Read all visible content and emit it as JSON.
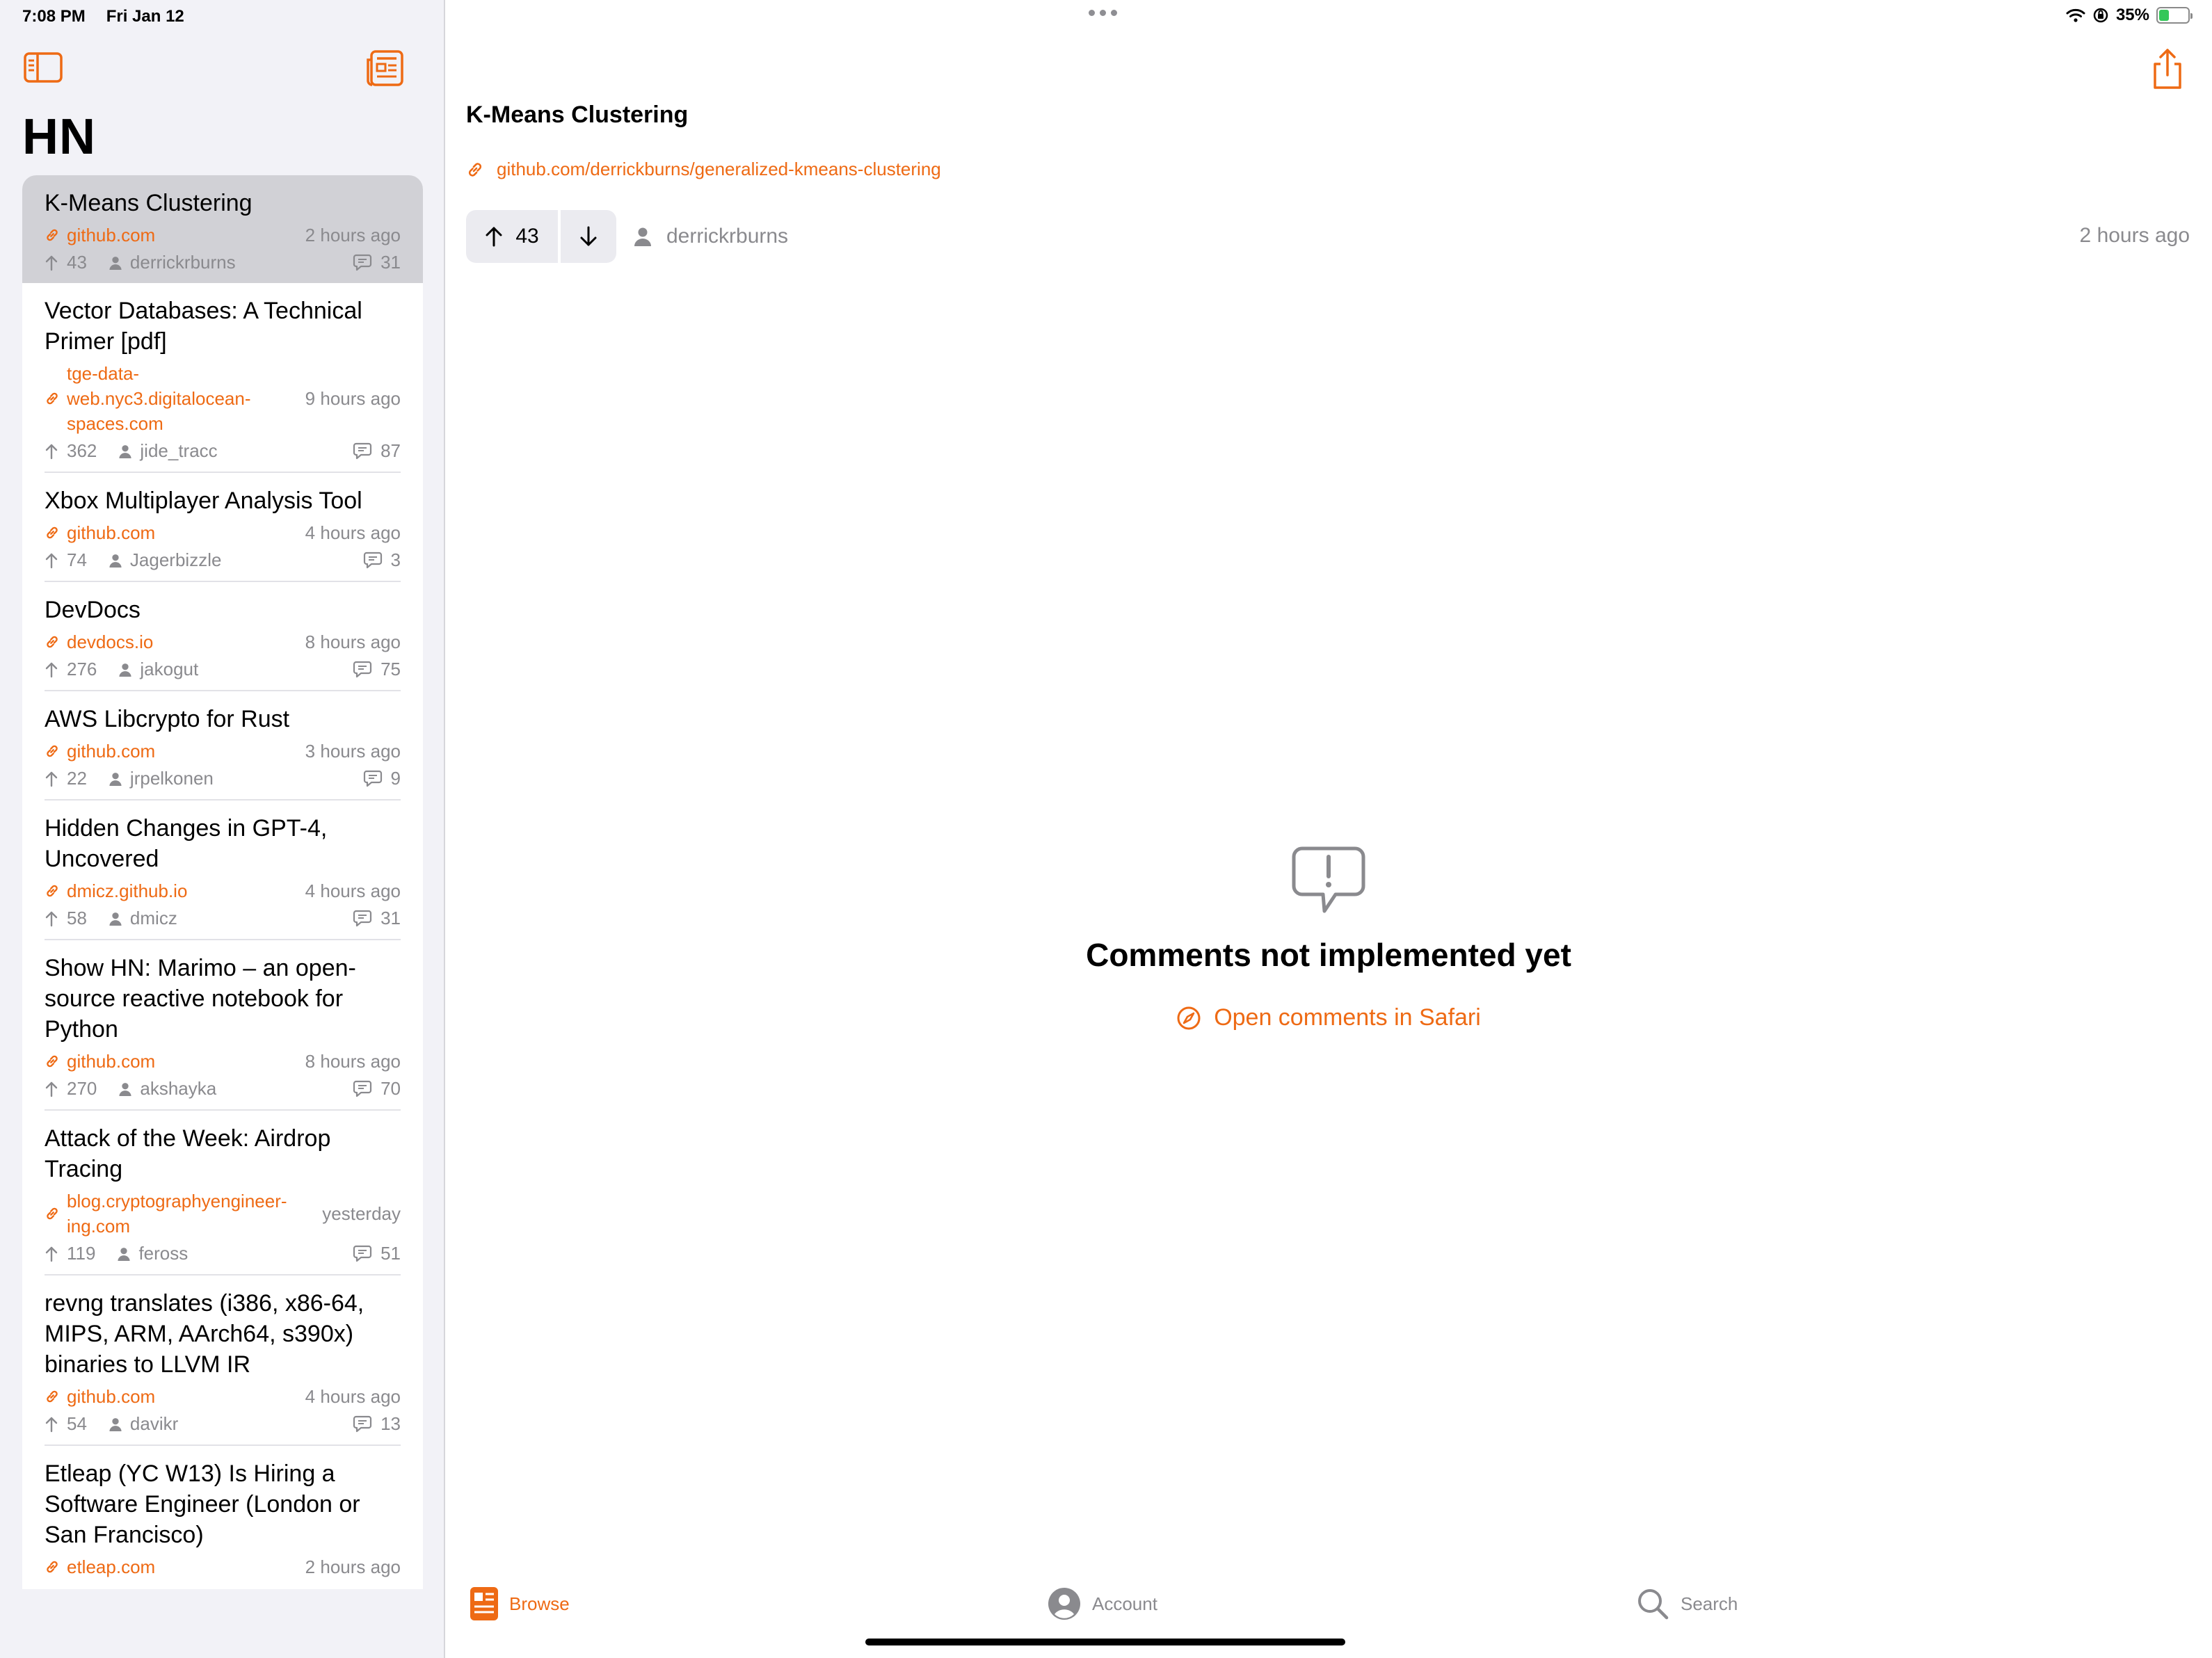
{
  "status_bar": {
    "time": "7:08 PM",
    "date": "Fri Jan 12",
    "battery": "35%",
    "battery_level": 0.35
  },
  "sidebar": {
    "title": "HN",
    "stories": [
      {
        "title": "K-Means Clustering",
        "site": "github.com",
        "age": "2 hours ago",
        "points": "43",
        "user": "derrickrburns",
        "comments": "31",
        "selected": true
      },
      {
        "title": "Vector Databases: A Technical Primer [pdf]",
        "site": "tge-data-web.nyc3.digitalocean-spaces.com",
        "age": "9 hours ago",
        "points": "362",
        "user": "jide_tracc",
        "comments": "87"
      },
      {
        "title": "Xbox Multiplayer Analysis Tool",
        "site": "github.com",
        "age": "4 hours ago",
        "points": "74",
        "user": "Jagerbizzle",
        "comments": "3"
      },
      {
        "title": "DevDocs",
        "site": "devdocs.io",
        "age": "8 hours ago",
        "points": "276",
        "user": "jakogut",
        "comments": "75"
      },
      {
        "title": "AWS Libcrypto for Rust",
        "site": "github.com",
        "age": "3 hours ago",
        "points": "22",
        "user": "jrpelkonen",
        "comments": "9"
      },
      {
        "title": "Hidden Changes in GPT-4, Uncovered",
        "site": "dmicz.github.io",
        "age": "4 hours ago",
        "points": "58",
        "user": "dmicz",
        "comments": "31"
      },
      {
        "title": "Show HN: Marimo – an open-source reactive notebook for Python",
        "site": "github.com",
        "age": "8 hours ago",
        "points": "270",
        "user": "akshayka",
        "comments": "70"
      },
      {
        "title": "Attack of the Week: Airdrop Tracing",
        "site": "blog.cryptographyengineer-ing.com",
        "age": "yesterday",
        "points": "119",
        "user": "feross",
        "comments": "51"
      },
      {
        "title": "revng translates (i386, x86-64, MIPS, ARM, AArch64, s390x) binaries to LLVM IR",
        "site": "github.com",
        "age": "4 hours ago",
        "points": "54",
        "user": "davikr",
        "comments": "13"
      },
      {
        "title": "Etleap (YC W13) Is Hiring a Software Engineer (London or San Francisco)",
        "site": "etleap.com",
        "age": "2 hours ago",
        "points": "",
        "user": "",
        "comments": ""
      }
    ]
  },
  "detail": {
    "title": "K-Means Clustering",
    "url": "github.com/derrickburns/generalized-kmeans-clustering",
    "points": "43",
    "user": "derrickrburns",
    "age": "2 hours ago",
    "empty_title": "Comments not implemented yet",
    "empty_action": "Open comments in Safari"
  },
  "tabs": [
    {
      "label": "Browse",
      "icon": "newspaper-icon",
      "active": true
    },
    {
      "label": "Account",
      "icon": "person-circle-icon",
      "active": false
    },
    {
      "label": "Search",
      "icon": "magnifier-icon",
      "active": false
    }
  ],
  "colors": {
    "accent": "#ee6a14",
    "secondary_text": "#8a8a8e",
    "sidebar_bg": "#f2f2f7",
    "selected_row": "#d1d1d6"
  }
}
